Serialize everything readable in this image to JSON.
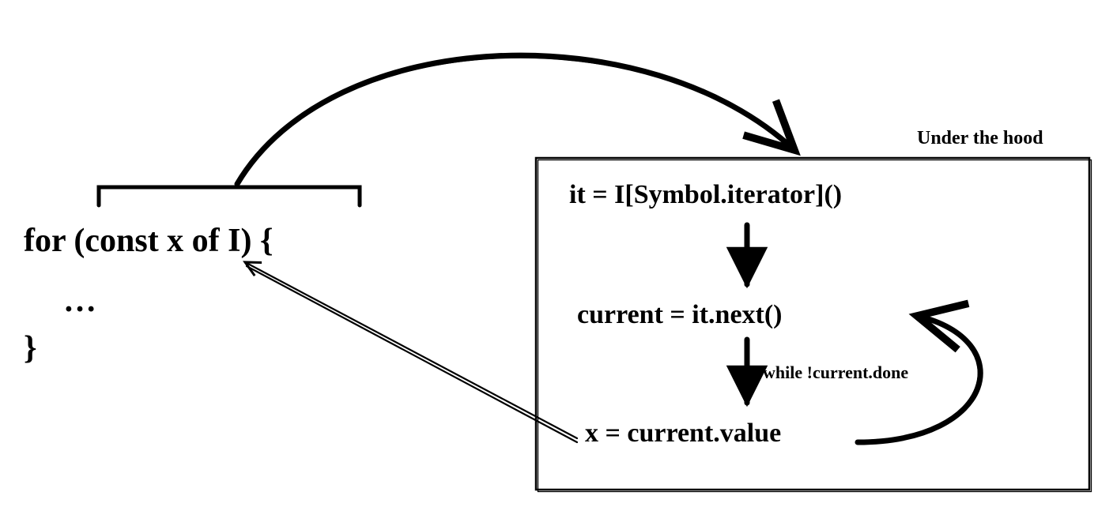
{
  "left": {
    "line1": "for (const x of I) {",
    "line2": "…",
    "line3": "}"
  },
  "right": {
    "title": "Under the hood",
    "step1": "it = I[Symbol.iterator]()",
    "step2": "current = it.next()",
    "cond": "while !current.done",
    "step3": "x = current.value"
  }
}
